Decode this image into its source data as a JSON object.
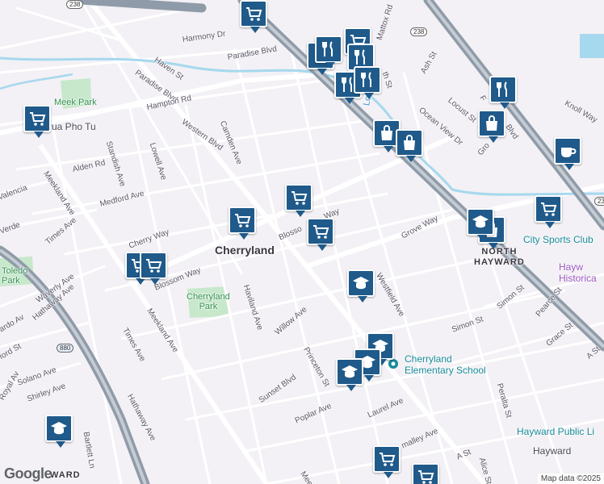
{
  "places": {
    "cherryland": "Cherryland",
    "north_hayward": "NORTH\nHAYWARD",
    "hayward": "Hayward",
    "ward": "WARD"
  },
  "parks": {
    "meek_park": "Meek Park",
    "cherryland_park": "Cherryland\nPark",
    "toledo_park": "Toledo\nPark"
  },
  "water": {
    "lorenzo": "Loren"
  },
  "pois": {
    "pho": "Pua Pho Tu",
    "city_sports": "City Sports Club",
    "school": "Cherryland\nElementary School",
    "library": "Hayward Public Li",
    "historical": "Hayw\nHistorica",
    "hayward_station": "Hayward"
  },
  "streets": {
    "harmony": "Harmony Dr",
    "paradise_blvd": "Paradise Blvd",
    "paradise_blvd2": "Paradise Blvd",
    "haven": "Haven St",
    "hampton": "Hampton Rd",
    "western": "Western Blvd",
    "camden": "Camden Ave",
    "lowell": "Lowell Ave",
    "standish": "Standish Ave",
    "alden": "Alden Rd",
    "medford": "Medford Ave",
    "meekland": "Meekland Ave",
    "meekland2": "Meekland Ave",
    "meekland3": "Meek",
    "valencia": "Valencia",
    "verde": "Verde",
    "times": "Times Ave",
    "times2": "Times Ave",
    "waverly": "Waverly Ave",
    "hathaway": "Hathaway Ave",
    "hathaway2": "Hathaway Ave",
    "cherry_way": "Cherry Way",
    "blossom": "Blossom Way",
    "blossom2": "Blosso",
    "blossom3": "Way",
    "haviland": "Haviland Ave",
    "willow": "Willow Ave",
    "princeton": "Princeton St",
    "grove": "Grove Way",
    "grove2": "Gro",
    "westfield": "Westfield Ave",
    "simon": "Simon St",
    "simon2": "Simon St",
    "pearce": "Pearce St",
    "grace": "Grace St",
    "peralta": "Peralta St",
    "sunset": "Sunset Blvd",
    "poplar": "Poplar Ave",
    "laurel": "Laurel Ave",
    "smalley": "malley Ave",
    "a_st": "A St",
    "a_st2": "A St",
    "alice": "Alice St",
    "solano": "Solano Ave",
    "shirley": "Shirley Ave",
    "royal": "Royal Av",
    "ford": "ford St",
    "ardo": "ardo Av",
    "bartlett": "Bartlett Ln",
    "ash": "Ash St",
    "locust": "Locust St",
    "ocean_view": "Ocean View Dr",
    "knoll": "Knoll Way",
    "mattox": "Mattox Rd",
    "th_st": "th St",
    "foothill": "F",
    "foothill2": "Blvd"
  },
  "shields": {
    "r238a": "238",
    "r238b": "238",
    "r238c": "238",
    "i880": "880"
  },
  "attribution": "Map data ©2025",
  "logo": "Google",
  "colors": {
    "pin": "#1f5a8a",
    "highway": "#8f9ba8",
    "water": "#a6d8ee",
    "park": "#c7e8cb"
  },
  "pins": [
    {
      "type": "shopping-cart"
    },
    {
      "type": "shopping-cart"
    },
    {
      "type": "shopping-cart"
    },
    {
      "type": "shopping-cart"
    },
    {
      "type": "shopping-cart"
    },
    {
      "type": "shopping-cart"
    },
    {
      "type": "shopping-cart"
    },
    {
      "type": "shopping-cart"
    },
    {
      "type": "shopping-cart"
    },
    {
      "type": "shopping-bag"
    },
    {
      "type": "shopping-bag"
    },
    {
      "type": "shopping-bag"
    },
    {
      "type": "shopping-bag"
    },
    {
      "type": "shopping-bag"
    },
    {
      "type": "restaurant"
    },
    {
      "type": "restaurant"
    },
    {
      "type": "restaurant"
    },
    {
      "type": "restaurant"
    },
    {
      "type": "restaurant"
    },
    {
      "type": "school"
    },
    {
      "type": "school"
    },
    {
      "type": "school"
    },
    {
      "type": "school"
    },
    {
      "type": "school"
    },
    {
      "type": "school"
    },
    {
      "type": "cafe"
    },
    {
      "type": "shopping-cart"
    },
    {
      "type": "shopping-cart"
    }
  ]
}
